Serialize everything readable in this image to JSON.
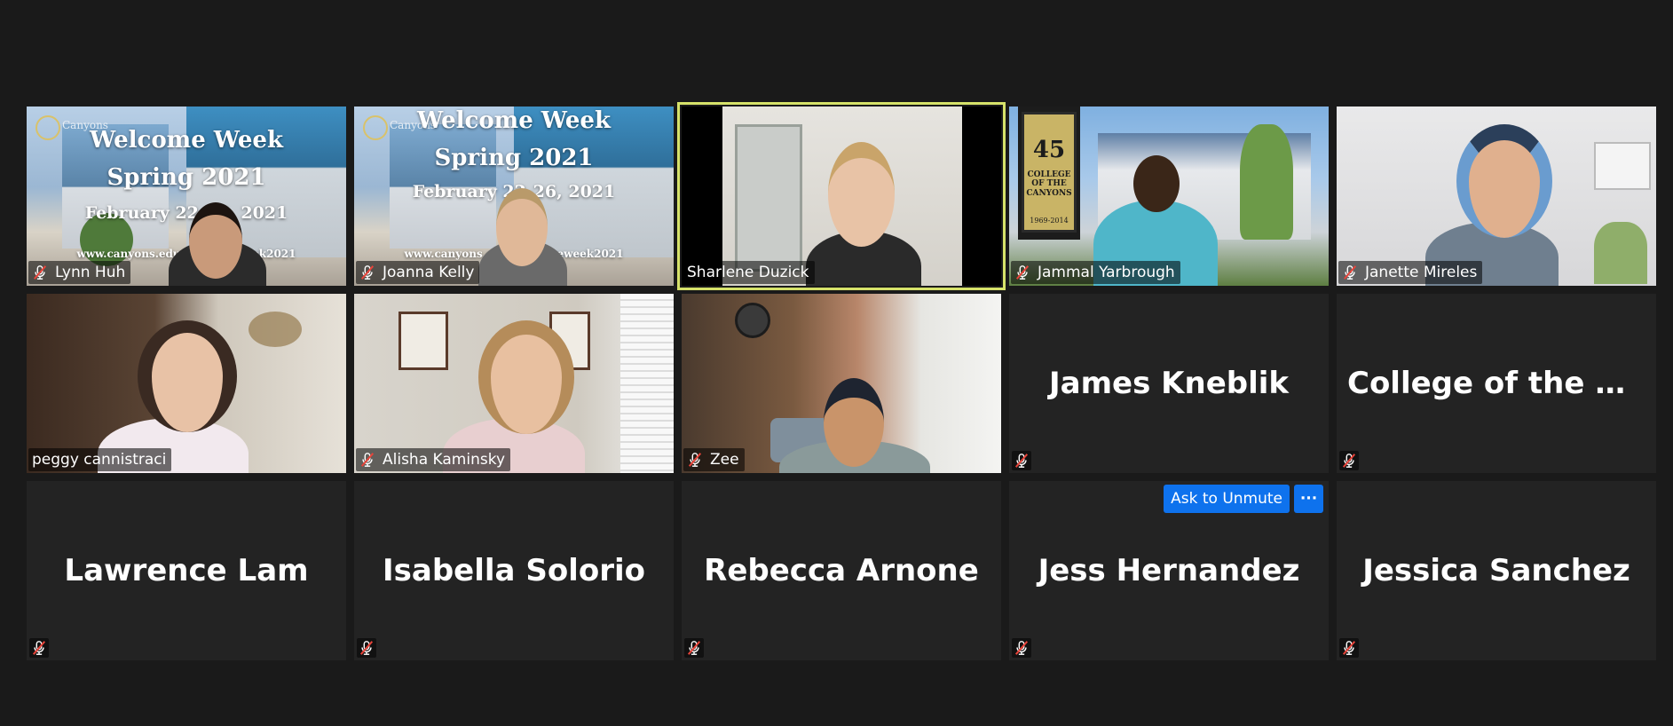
{
  "colors": {
    "background": "#1a1a1a",
    "tile": "#232323",
    "active_speaker_border": "#d6e26a",
    "button": "#0e72ed",
    "muted_icon": "#e8443a"
  },
  "promo": {
    "logo_text": "Canyons",
    "line1": "Welcome Week",
    "line2": "Spring 2021",
    "line3_a": "February 22-26, 2021",
    "line3_b": "February 22-26, 2021",
    "url_a": "www.canyons.edu/welcomeweek2021",
    "url_b": "www.canyons.edu/welcomeweek2021"
  },
  "banner_sign": {
    "number": "45",
    "text": "COLLEGE OF THE CANYONS",
    "years": "1969-2014"
  },
  "participants": [
    {
      "name": "Lynn Huh",
      "muted": true,
      "video": true
    },
    {
      "name": "Joanna Kelly",
      "muted": true,
      "video": true
    },
    {
      "name": "Sharlene Duzick",
      "muted": false,
      "video": true,
      "active_speaker": true
    },
    {
      "name": "Jammal Yarbrough",
      "muted": true,
      "video": true
    },
    {
      "name": "Janette Mireles",
      "muted": true,
      "video": true
    },
    {
      "name": "peggy cannistraci",
      "muted": false,
      "video": true
    },
    {
      "name": "Alisha Kaminsky",
      "muted": true,
      "video": true
    },
    {
      "name": "Zee",
      "muted": true,
      "video": true
    },
    {
      "name": "James Kneblik",
      "muted": true,
      "video": false
    },
    {
      "name": "College of the C...",
      "muted": true,
      "video": false
    },
    {
      "name": "Lawrence Lam",
      "muted": true,
      "video": false
    },
    {
      "name": "Isabella Solorio",
      "muted": true,
      "video": false
    },
    {
      "name": "Rebecca Arnone",
      "muted": true,
      "video": false
    },
    {
      "name": "Jess Hernandez",
      "muted": true,
      "video": false
    },
    {
      "name": "Jessica Sanchez",
      "muted": true,
      "video": false
    }
  ],
  "hover_controls": {
    "ask_to_unmute": "Ask to Unmute",
    "more": "···"
  },
  "icons": {
    "muted": "muted-microphone-icon",
    "more": "more-options-icon"
  }
}
